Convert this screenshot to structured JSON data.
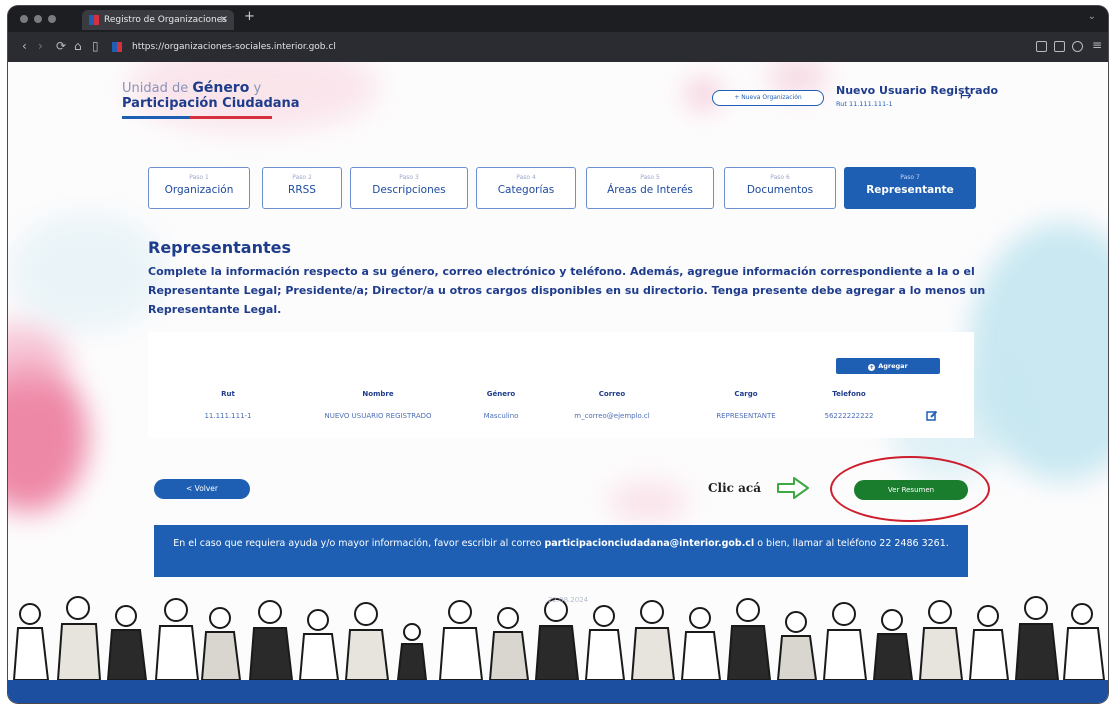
{
  "browser": {
    "tab_title": "Registro de Organizaciones",
    "tab_close": "×",
    "new_tab": "+",
    "url": "https://organizaciones-sociales.interior.gob.cl"
  },
  "logo": {
    "line1_prefix": "Unidad de",
    "line1_bold": "Género",
    "line1_suffix": "y",
    "line2": "Participación Ciudadana"
  },
  "header": {
    "new_org_button": "+ Nueva Organización",
    "user_name": "Nuevo Usuario Registrado",
    "user_rut": "Rut 11.111.111-1",
    "logout_icon": "logout-icon"
  },
  "steps": [
    {
      "small": "Paso 1",
      "label": "Organización"
    },
    {
      "small": "Paso 2",
      "label": "RRSS"
    },
    {
      "small": "Paso 3",
      "label": "Descripciones"
    },
    {
      "small": "Paso 4",
      "label": "Categorías"
    },
    {
      "small": "Paso 5",
      "label": "Áreas de Interés"
    },
    {
      "small": "Paso 6",
      "label": "Documentos"
    },
    {
      "small": "Paso 7",
      "label": "Representante"
    }
  ],
  "active_step": 7,
  "section": {
    "title": "Representantes",
    "description": "Complete la información respecto a su género, correo electrónico y teléfono. Además, agregue información correspondiente a la o el Representante Legal; Presidente/a; Director/a u otros cargos disponibles en su directorio. Tenga presente debe agregar a lo menos un Representante Legal."
  },
  "table": {
    "add_button": "Agregar",
    "headers": [
      "Rut",
      "Nombre",
      "Género",
      "Correo",
      "Cargo",
      "Telefono"
    ],
    "rows": [
      {
        "rut": "11.111.111-1",
        "nombre": "NUEVO USUARIO REGISTRADO",
        "genero": "Masculino",
        "correo": "m_correo@ejemplo.cl",
        "cargo": "REPRESENTANTE",
        "telefono": "56222222222"
      }
    ]
  },
  "actions": {
    "back_button": "< Volver",
    "clic_label": "Clic acá",
    "summary_button": "Ver Resumen"
  },
  "help": {
    "text_before": "En el caso que requiera ayuda y/o mayor información, favor escribir al correo ",
    "email": "participacionciudadana@interior.gob.cl",
    "text_after": " o bien, llamar al teléfono 22 2486 3261."
  },
  "footer": {
    "date": "22.08.2024"
  },
  "colors": {
    "primary": "#1e5fb4",
    "navy": "#1e3c8c",
    "accent_red": "#d62f3e",
    "success": "#1a7d2d",
    "annotation_red": "#cc1e2c"
  }
}
